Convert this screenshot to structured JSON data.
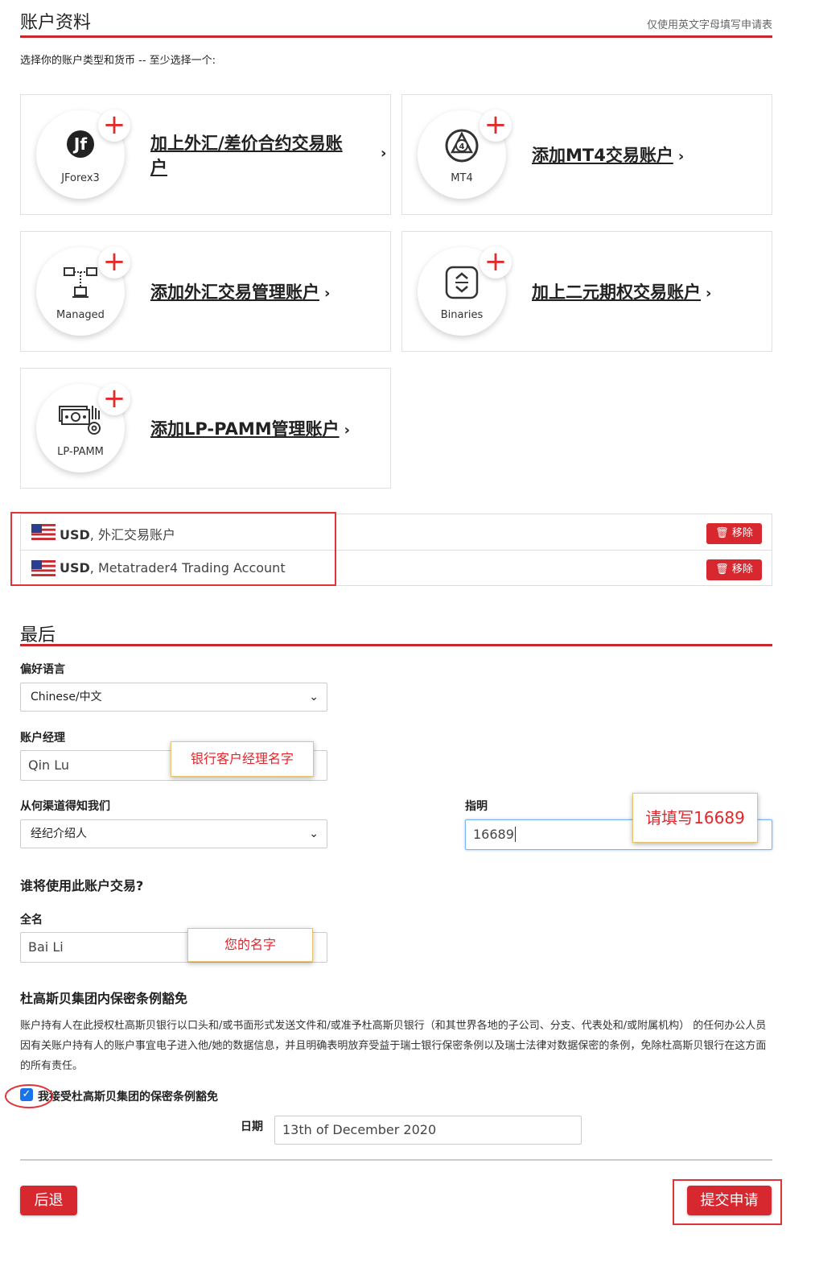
{
  "header": {
    "title": "账户资料",
    "hint": "仅使用英文字母填写申请表",
    "intro": "选择你的账户类型和货币 -- 至少选择一个:"
  },
  "cards": [
    {
      "icon_label": "JForex3",
      "link": "加上外汇/差价合约交易账户",
      "icon": "jforex-icon"
    },
    {
      "icon_label": "MT4",
      "link": "添加MT4交易账户",
      "icon": "mt4-icon"
    },
    {
      "icon_label": "Managed",
      "link": "添加外汇交易管理账户",
      "icon": "managed-network-icon"
    },
    {
      "icon_label": "Binaries",
      "link": "加上二元期权交易账户",
      "icon": "binaries-icon"
    },
    {
      "icon_label": "LP-PAMM",
      "link": "添加LP-PAMM管理账户",
      "icon": "lp-pamm-icon"
    }
  ],
  "accounts": [
    {
      "currency": "USD",
      "name": ", 外汇交易账户",
      "remove": "移除"
    },
    {
      "currency": "USD",
      "name": ", Metatrader4 Trading Account",
      "remove": "移除"
    }
  ],
  "final": {
    "title": "最后",
    "lang_label": "偏好语言",
    "lang_value": "Chinese/中文",
    "manager_label": "账户经理",
    "manager_value": "Qin Lu",
    "manager_note": "银行客户经理名字",
    "channel_label": "从何渠道得知我们",
    "channel_value": "经纪介绍人",
    "specify_label": "指明",
    "specify_value": "16689",
    "specify_note": "请填写16689"
  },
  "trader": {
    "title": "谁将使用此账户交易?",
    "fullname_label": "全名",
    "fullname_value": "Bai Li",
    "fullname_note": "您的名字"
  },
  "waiver": {
    "title": "杜高斯贝集团内保密条例豁免",
    "text": "账户持有人在此授权杜高斯贝银行以口头和/或书面形式发送文件和/或准予杜高斯贝银行（和其世界各地的子公司、分支、代表处和/或附属机构） 的任何办公人员因有关账户持有人的账户事宜电子进入他/她的数据信息，并且明确表明放弃受益于瑞士银行保密条例以及瑞士法律对数据保密的条例，免除杜高斯贝银行在这方面的所有责任。",
    "checkbox_label": "我接受杜高斯贝集团的保密条例豁免",
    "date_label": "日期",
    "date_value": "13th of December 2020"
  },
  "buttons": {
    "back": "后退",
    "submit": "提交申请"
  },
  "colors": {
    "accent": "#d7282f",
    "rule": "#c8282d",
    "highlight": "#e3333a"
  }
}
